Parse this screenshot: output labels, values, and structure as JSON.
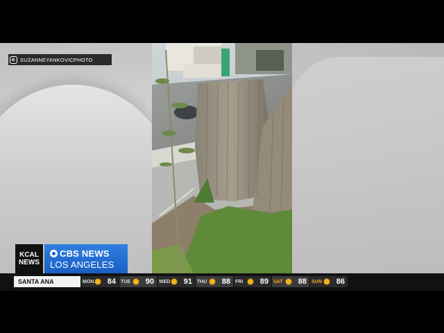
{
  "credit": {
    "icon": "instagram-icon",
    "handle": "SUZANNEYANKOVICPHOTO"
  },
  "logos": {
    "kcal_line1": "KCAL",
    "kcal_line2": "NEWS",
    "cbs_name": "CBS NEWS",
    "cbs_city": "LOS ANGELES",
    "cbs_brand_color": "#1f6fd6"
  },
  "ticker": {
    "city": "SANTA ANA",
    "days": [
      {
        "day": "MON",
        "icon": "sun-icon",
        "temp": "84"
      },
      {
        "day": "TUE",
        "icon": "sun-icon",
        "temp": "90"
      },
      {
        "day": "WED",
        "icon": "sun-icon",
        "temp": "91"
      },
      {
        "day": "THU",
        "icon": "sun-icon",
        "temp": "88"
      },
      {
        "day": "FRI",
        "icon": "sun-icon",
        "temp": "89"
      },
      {
        "day": "SAT",
        "icon": "sun-icon",
        "temp": "88"
      },
      {
        "day": "SUN",
        "icon": "sun-icon",
        "temp": "86"
      }
    ]
  }
}
